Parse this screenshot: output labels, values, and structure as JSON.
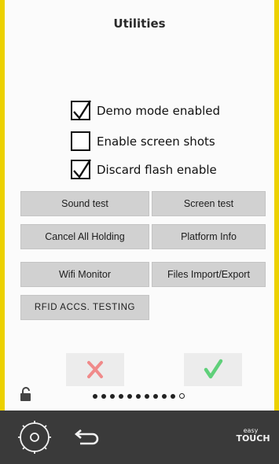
{
  "screen": {
    "title": "Utilities"
  },
  "options": [
    {
      "label": "Demo mode enabled",
      "checked": true
    },
    {
      "label": "Enable screen shots",
      "checked": false
    },
    {
      "label": "Discard flash enable",
      "checked": true
    }
  ],
  "buttons": {
    "sound_test": "Sound test",
    "screen_test": "Screen test",
    "cancel_all_holding": "Cancel All Holding",
    "platform_info": "Platform Info",
    "wifi_monitor": "Wifi Monitor",
    "files_import_export": "Files Import/Export",
    "rfid_accs_testing": "RFID ACCS. TESTING"
  },
  "actions": {
    "cancel_icon": "x-icon",
    "confirm_icon": "check-icon",
    "cancel_color": "#f08a8a",
    "confirm_color": "#5fd07a"
  },
  "pager": {
    "total_pages": 11,
    "current_page": 11
  },
  "footer": {
    "settings_icon": "gear-icon",
    "back_icon": "back-arrow-icon",
    "brand_line1": "easy",
    "brand_line2": "TOUCH"
  },
  "colors": {
    "frame": "#ecd100",
    "button": "#d1d1d1",
    "footer": "#3a3a3a"
  }
}
